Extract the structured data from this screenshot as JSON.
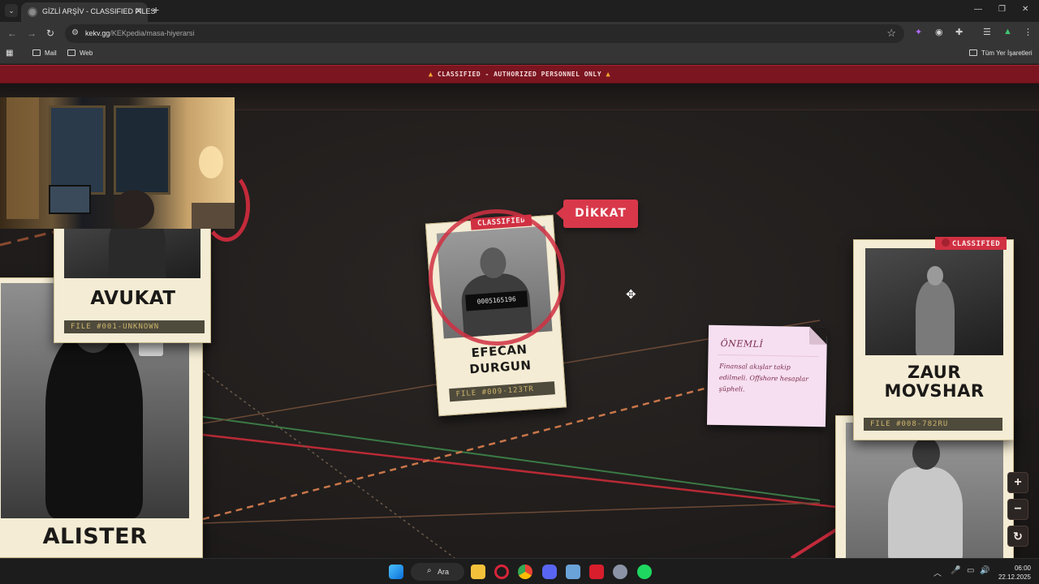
{
  "browser": {
    "tab_title": "GİZLİ ARŞİV - CLASSIFIED FILES",
    "url_host": "kekv.gg",
    "url_path": "/KEKpedia/masa-hiyerarsi",
    "bookmarks": [
      "Mail",
      "Web"
    ],
    "all_bookmarks_label": "Tüm Yer İşaretleri"
  },
  "banner": {
    "text": "CLASSIFIED - AUTHORIZED PERSONNEL ONLY"
  },
  "cards": [
    {
      "name": "AVUKAT",
      "file": "FILE #001-UNKNOWN"
    },
    {
      "name": "ALISTER",
      "file": ""
    },
    {
      "name_line1": "EFECAN",
      "name_line2": "DURGUN",
      "file": "FILE #009-123TR",
      "tag": "CLASSIFIED",
      "mugshot_number": "0005165196"
    },
    {
      "name_line1": "ZAUR",
      "name_line2": "MOVSHAR",
      "file": "FILE #008-782RU",
      "tag": "CLASSIFIED"
    }
  ],
  "alert_tag": "DİKKAT",
  "note": {
    "title": "ÖNEMLİ",
    "body": "Finansal akışlar takip edilmeli. Offshore hesaplar şüpheli."
  },
  "zoom_controls": {
    "zoom_in": "+",
    "zoom_out": "−",
    "reset": "↻"
  },
  "taskbar": {
    "search_label": "Ara",
    "time": "06:00",
    "date": "22.12.2025"
  },
  "colors": {
    "banner": "#7b1520",
    "accent_red": "#d03042",
    "file_label": "#cdb56c",
    "note_bg": "#f6dff0"
  }
}
